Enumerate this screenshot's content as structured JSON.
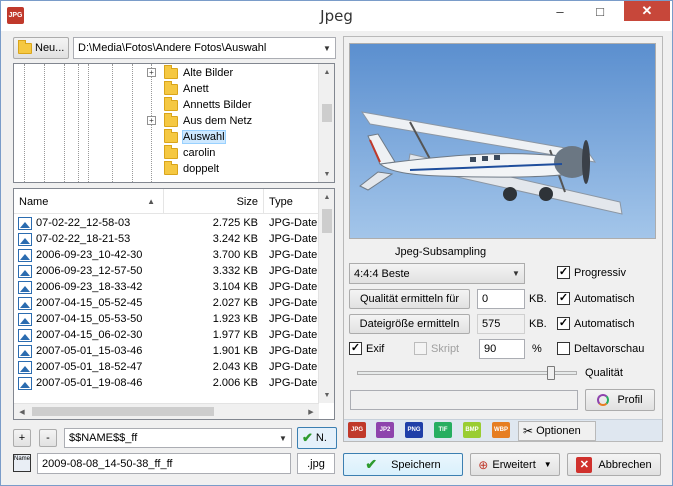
{
  "window": {
    "title": "Jpeg",
    "app_icon": "JPG",
    "minimize": "–",
    "maximize": "□",
    "close": "✕"
  },
  "toolbar": {
    "new_label": "Neu..."
  },
  "path": {
    "value": "D:\\Media\\Fotos\\Andere Fotos\\Auswahl"
  },
  "tree": {
    "items": [
      {
        "label": "Alte Bilder",
        "expander": "+"
      },
      {
        "label": "Anett",
        "expander": ""
      },
      {
        "label": "Annetts Bilder",
        "expander": ""
      },
      {
        "label": "Aus dem Netz",
        "expander": "+"
      },
      {
        "label": "Auswahl",
        "expander": "",
        "selected": true
      },
      {
        "label": "carolin",
        "expander": ""
      },
      {
        "label": "doppelt",
        "expander": ""
      }
    ]
  },
  "filelist": {
    "columns": {
      "name": "Name",
      "size": "Size",
      "type": "Type"
    },
    "rows": [
      {
        "name": "07-02-22_12-58-03",
        "size": "2.725 KB",
        "type": "JPG-Datei"
      },
      {
        "name": "07-02-22_18-21-53",
        "size": "3.242 KB",
        "type": "JPG-Datei"
      },
      {
        "name": "2006-09-23_10-42-30",
        "size": "3.700 KB",
        "type": "JPG-Datei"
      },
      {
        "name": "2006-09-23_12-57-50",
        "size": "3.332 KB",
        "type": "JPG-Datei"
      },
      {
        "name": "2006-09-23_18-33-42",
        "size": "3.104 KB",
        "type": "JPG-Datei"
      },
      {
        "name": "2007-04-15_05-52-45",
        "size": "2.027 KB",
        "type": "JPG-Datei"
      },
      {
        "name": "2007-04-15_05-53-50",
        "size": "1.923 KB",
        "type": "JPG-Datei"
      },
      {
        "name": "2007-04-15_06-02-30",
        "size": "1.977 KB",
        "type": "JPG-Datei"
      },
      {
        "name": "2007-05-01_15-03-46",
        "size": "1.901 KB",
        "type": "JPG-Datei"
      },
      {
        "name": "2007-05-01_18-52-47",
        "size": "2.043 KB",
        "type": "JPG-Datei"
      },
      {
        "name": "2007-05-01_19-08-46",
        "size": "2.006 KB",
        "type": "JPG-Datei"
      }
    ]
  },
  "pattern": {
    "plus": "+",
    "minus": "-",
    "value": "$$NAME$$_ff",
    "apply": "N."
  },
  "filename": {
    "icon_label": "Name",
    "value": "2009-08-08_14-50-38_ff_ff",
    "extension": ".jpg"
  },
  "settings": {
    "subsampling_label": "Jpeg-Subsampling",
    "subsampling_value": "4:4:4 Beste",
    "progressive": "Progressiv",
    "quality_button": "Qualität ermitteln für",
    "quality_input": "0",
    "quality_unit": "KB.",
    "auto1": "Automatisch",
    "size_button": "Dateigröße ermitteln",
    "size_value": "575",
    "size_unit": "KB.",
    "auto2": "Automatisch",
    "exif": "Exif",
    "script": "Skript",
    "quality_percent": "90",
    "percent_sign": "%",
    "delta_preview": "Deltavorschau",
    "quality_label": "Qualität",
    "quality_slider": 0.9,
    "profile": "Profil"
  },
  "format_tabs": [
    {
      "label": "JPG",
      "color": "#c0392b"
    },
    {
      "label": "JP2",
      "color": "#8e44ad"
    },
    {
      "label": "PNG",
      "color": "#1f3fa8"
    },
    {
      "label": "TIF",
      "color": "#27ae60"
    },
    {
      "label": "BMP",
      "color": "#9acd32"
    },
    {
      "label": "WBP",
      "color": "#e67e22"
    }
  ],
  "options_tab": "Optionen",
  "actions": {
    "save": "Speichern",
    "advanced": "Erweitert",
    "cancel": "Abbrechen"
  },
  "colors": {
    "accent": "#0078d7",
    "close": "#c7473a",
    "tab_bar": "#dfe7f0"
  }
}
